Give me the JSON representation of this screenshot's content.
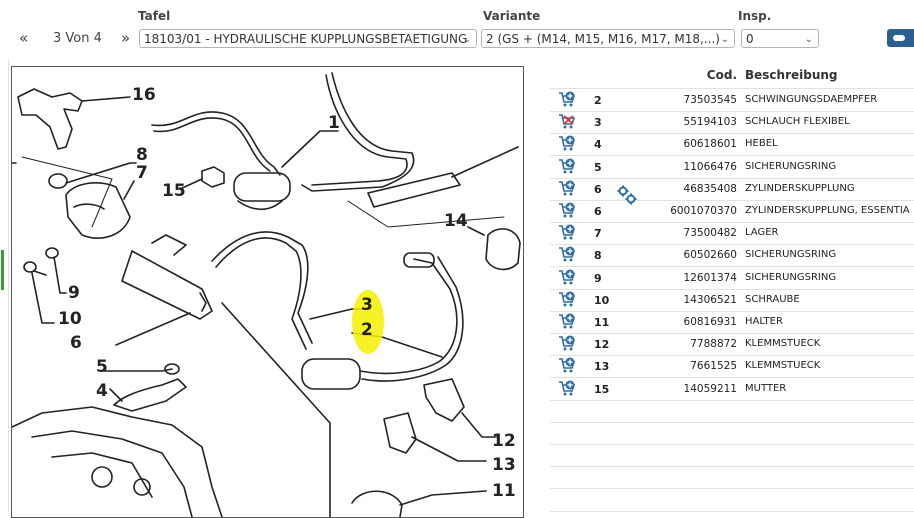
{
  "header": {
    "tafel_label": "Tafel",
    "variante_label": "Variante",
    "insp_label": "Insp.",
    "first_icon": "«",
    "page_indicator": "3 Von 4",
    "next_icon": "»",
    "tafel_value": "18103/01 - HYDRAULISCHE KUPPLUNGSBETAETIGUNG",
    "variante_value": "2 (GS + (M14, M15, M16, M17, M18,...)",
    "insp_value": "0"
  },
  "table": {
    "col_code": "Cod.",
    "col_desc": "Beschreibung",
    "rows": [
      {
        "pos": "2",
        "code": "73503545",
        "desc": "SCHWINGUNGSDAEMPFER",
        "status": "add"
      },
      {
        "pos": "3",
        "code": "55194103",
        "desc": "SCHLAUCH FLEXIBEL",
        "status": "unavailable"
      },
      {
        "pos": "4",
        "code": "60618601",
        "desc": "HEBEL",
        "status": "add"
      },
      {
        "pos": "5",
        "code": "11066476",
        "desc": "SICHERUNGSRING",
        "status": "add"
      },
      {
        "pos": "6",
        "code": "46835408",
        "desc": "ZYLINDERSKUPPLUNG",
        "status": "add"
      },
      {
        "pos": "6",
        "code": "6001070370",
        "desc": "ZYLINDERSKUPPLUNG, ESSENTIA",
        "status": "add"
      },
      {
        "pos": "7",
        "code": "73500482",
        "desc": "LAGER",
        "status": "add"
      },
      {
        "pos": "8",
        "code": "60502660",
        "desc": "SICHERUNGSRING",
        "status": "add"
      },
      {
        "pos": "9",
        "code": "12601374",
        "desc": "SICHERUNGSRING",
        "status": "add"
      },
      {
        "pos": "10",
        "code": "14306521",
        "desc": "SCHRAUBE",
        "status": "add"
      },
      {
        "pos": "11",
        "code": "60816931",
        "desc": "HALTER",
        "status": "add"
      },
      {
        "pos": "12",
        "code": "7788872",
        "desc": "KLEMMSTUECK",
        "status": "add"
      },
      {
        "pos": "13",
        "code": "7661525",
        "desc": "KLEMMSTUECK",
        "status": "add"
      },
      {
        "pos": "15",
        "code": "14059211",
        "desc": "MUTTER",
        "status": "add"
      }
    ]
  },
  "diagram": {
    "callouts": [
      "16",
      "1",
      "8",
      "7",
      "15",
      "14",
      "9",
      "10",
      "3",
      "2",
      "6",
      "5",
      "4",
      "12",
      "13",
      "11"
    ]
  },
  "colors": {
    "add": "#2e6da4",
    "accent": "#2a5f8f",
    "highlight": "#f5f000",
    "remove": "#d33"
  }
}
